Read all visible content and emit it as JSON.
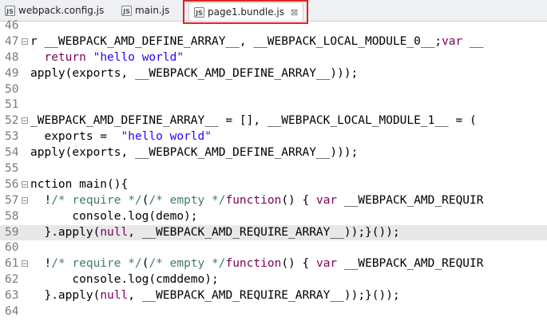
{
  "tabs": [
    {
      "label": "webpack.config.js"
    },
    {
      "label": "main.js"
    },
    {
      "label": "page1.bundle.js",
      "close": "⊠"
    }
  ],
  "lines": [
    {
      "n": "46",
      "parts": []
    },
    {
      "n": "47",
      "parts": [
        [
          "r __WEBPACK_AMD_DEFINE_ARRAY__, __WEBPACK_LOCAL_MODULE_0__;",
          ""
        ],
        [
          "var",
          "kw"
        ],
        [
          " __",
          ""
        ]
      ]
    },
    {
      "n": "48",
      "parts": [
        [
          "  ",
          ""
        ],
        [
          "return",
          "kw"
        ],
        [
          " ",
          ""
        ],
        [
          "\"hello world\"",
          "str"
        ]
      ]
    },
    {
      "n": "49",
      "parts": [
        [
          "apply(exports, __WEBPACK_AMD_DEFINE_ARRAY__)));",
          ""
        ]
      ]
    },
    {
      "n": "50",
      "parts": []
    },
    {
      "n": "51",
      "parts": []
    },
    {
      "n": "52",
      "parts": [
        [
          "_WEBPACK_AMD_DEFINE_ARRAY__ = [], __WEBPACK_LOCAL_MODULE_1__ = (",
          ""
        ]
      ]
    },
    {
      "n": "53",
      "parts": [
        [
          "  exports =  ",
          ""
        ],
        [
          "\"hello world\"",
          "str"
        ]
      ]
    },
    {
      "n": "54",
      "parts": [
        [
          "apply(exports, __WEBPACK_AMD_DEFINE_ARRAY__)));",
          ""
        ]
      ]
    },
    {
      "n": "55",
      "parts": []
    },
    {
      "n": "56",
      "parts": [
        [
          "nction main(){",
          ""
        ]
      ]
    },
    {
      "n": "57",
      "parts": [
        [
          "  !",
          ""
        ],
        [
          "/* require */",
          "cm"
        ],
        [
          "(",
          ""
        ],
        [
          "/* empty */",
          "cm"
        ],
        [
          "function",
          "kw"
        ],
        [
          "() { ",
          ""
        ],
        [
          "var",
          "kw"
        ],
        [
          " __WEBPACK_AMD_REQUIR",
          ""
        ]
      ]
    },
    {
      "n": "58",
      "parts": [
        [
          "      console.log(demo);",
          ""
        ]
      ]
    },
    {
      "n": "59",
      "parts": [
        [
          "  }.apply(",
          ""
        ],
        [
          "null",
          "kw"
        ],
        [
          ", __WEBPACK_AMD_REQUIRE_ARRAY__));}());",
          ""
        ]
      ]
    },
    {
      "n": "60",
      "parts": []
    },
    {
      "n": "61",
      "parts": [
        [
          "  !",
          ""
        ],
        [
          "/* require */",
          "cm"
        ],
        [
          "(",
          ""
        ],
        [
          "/* empty */",
          "cm"
        ],
        [
          "function",
          "kw"
        ],
        [
          "() { ",
          ""
        ],
        [
          "var",
          "kw"
        ],
        [
          " __WEBPACK_AMD_REQUIR",
          ""
        ]
      ]
    },
    {
      "n": "62",
      "parts": [
        [
          "      console.log(cmddemo);",
          ""
        ]
      ]
    },
    {
      "n": "63",
      "parts": [
        [
          "  }.apply(",
          ""
        ],
        [
          "null",
          "kw"
        ],
        [
          ", __WEBPACK_AMD_REQUIRE_ARRAY__));}());",
          ""
        ]
      ]
    },
    {
      "n": "64",
      "parts": []
    }
  ],
  "fold_lines": [
    "47",
    "52",
    "56",
    "57",
    "61"
  ],
  "current_line": "59",
  "colors": {
    "highlight": "#e0261f",
    "keyword": "#7f0055",
    "string": "#2a00ff",
    "comment": "#3f7f5f"
  }
}
